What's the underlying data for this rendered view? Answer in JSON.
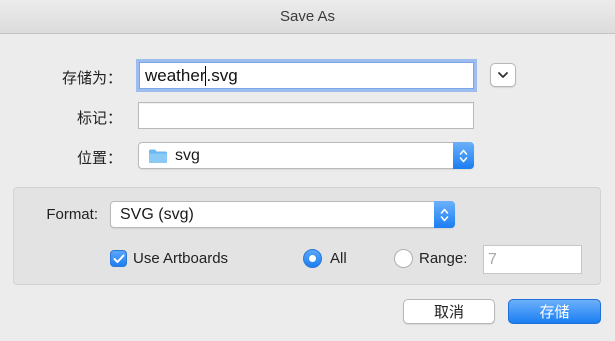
{
  "window": {
    "title": "Save As"
  },
  "form": {
    "save_as_label": "存储为：",
    "filename_value_before_caret": "weather",
    "filename_value_after_caret": ".svg",
    "tags_label": "标记：",
    "tags_value": "",
    "location_label": "位置：",
    "location_value": "svg",
    "location_icon": "folder-icon"
  },
  "format_panel": {
    "format_label": "Format:",
    "format_value": "SVG (svg)",
    "use_artboards_label": "Use Artboards",
    "use_artboards_checked": true,
    "all_label": "All",
    "all_selected": true,
    "range_label": "Range:",
    "range_selected": false,
    "range_value": "7"
  },
  "buttons": {
    "cancel_label": "取消",
    "save_label": "存储"
  },
  "colors": {
    "accent": "#1a7ef2",
    "window_bg": "#ececec",
    "panel_bg": "#e3e3e3",
    "folder": "#6cb8f0"
  }
}
